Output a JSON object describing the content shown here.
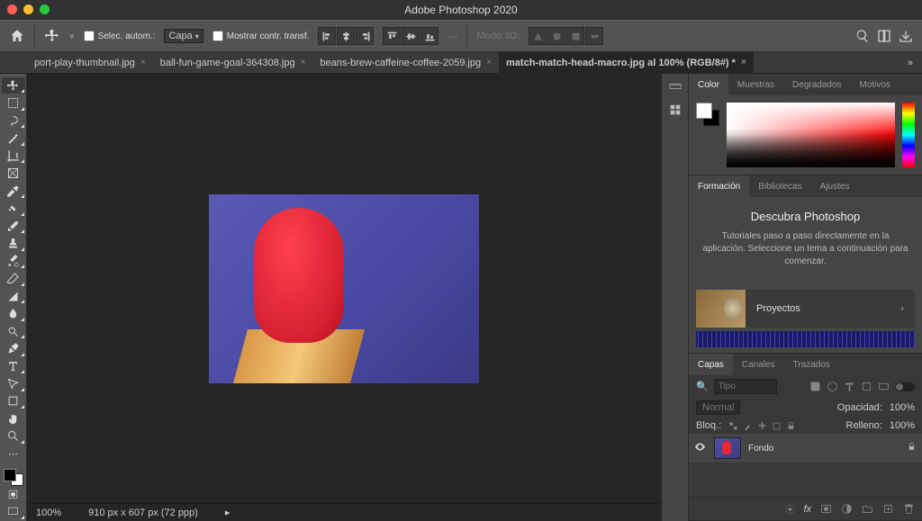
{
  "app_title": "Adobe Photoshop 2020",
  "options": {
    "auto_select_label": "Selec. autom.:",
    "layer_dropdown": "Capa",
    "show_transform_label": "Mostrar contr. transf.",
    "mode_3d": "Modo 3D:"
  },
  "tabs": [
    {
      "name": "port-play-thumbnail.jpg",
      "active": false
    },
    {
      "name": "ball-fun-game-goal-364308.jpg",
      "active": false
    },
    {
      "name": "beans-brew-caffeine-coffee-2059.jpg",
      "active": false
    },
    {
      "name": "match-match-head-macro.jpg al 100% (RGB/8#) *",
      "active": true
    }
  ],
  "status": {
    "zoom": "100%",
    "doc": "910 px x 607 px (72 ppp)"
  },
  "panels": {
    "color": {
      "tabs": [
        "Color",
        "Muestras",
        "Degradados",
        "Motivos"
      ],
      "active": 0
    },
    "learn": {
      "tabs": [
        "Formación",
        "Bibliotecas",
        "Ajustes"
      ],
      "active": 0,
      "heading": "Descubra Photoshop",
      "text": "Tutoriales paso a paso directamente en la aplicación. Seleccione un tema a continuación para comenzar.",
      "tile_label": "Proyectos"
    },
    "layers": {
      "tabs": [
        "Capas",
        "Canales",
        "Trazados"
      ],
      "active": 0,
      "search_placeholder": "Tipo",
      "blend": "Normal",
      "opacity_label": "Opacidad:",
      "opacity_value": "100%",
      "lock_label": "Bloq.:",
      "fill_label": "Relleno:",
      "fill_value": "100%",
      "items": [
        {
          "name": "Fondo",
          "locked": true
        }
      ]
    }
  }
}
